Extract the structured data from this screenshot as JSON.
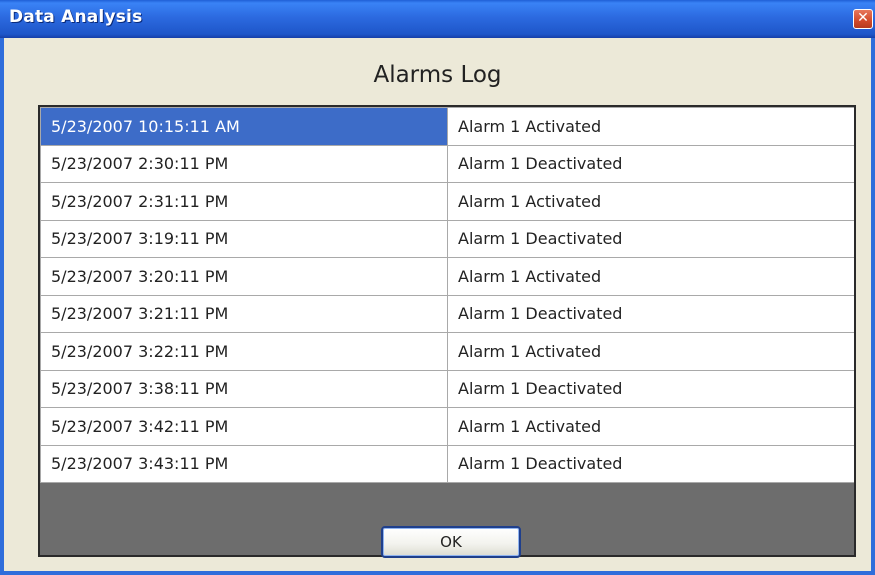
{
  "window": {
    "title": "Data Analysis",
    "close_glyph": "✕",
    "close_icon": "close-icon"
  },
  "heading": "Alarms Log",
  "log": {
    "selected_row": 0,
    "selection_color": "#3d6cc8",
    "rows": [
      {
        "timestamp": "5/23/2007 10:15:11 AM",
        "event": "Alarm 1 Activated"
      },
      {
        "timestamp": "5/23/2007 2:30:11 PM",
        "event": "Alarm 1 Deactivated"
      },
      {
        "timestamp": "5/23/2007 2:31:11 PM",
        "event": "Alarm 1 Activated"
      },
      {
        "timestamp": "5/23/2007 3:19:11 PM",
        "event": "Alarm 1 Deactivated"
      },
      {
        "timestamp": "5/23/2007 3:20:11 PM",
        "event": "Alarm 1 Activated"
      },
      {
        "timestamp": "5/23/2007 3:21:11 PM",
        "event": "Alarm 1 Deactivated"
      },
      {
        "timestamp": "5/23/2007 3:22:11 PM",
        "event": "Alarm 1 Activated"
      },
      {
        "timestamp": "5/23/2007 3:38:11 PM",
        "event": "Alarm 1 Deactivated"
      },
      {
        "timestamp": "5/23/2007 3:42:11 PM",
        "event": "Alarm 1 Activated"
      },
      {
        "timestamp": "5/23/2007 3:43:11 PM",
        "event": "Alarm 1 Deactivated"
      }
    ]
  },
  "ok_button": {
    "label": "OK"
  },
  "colors": {
    "titlebar": "#2c6ae0",
    "window_face": "#ece9d8",
    "grid_background": "#6d6d6d"
  }
}
